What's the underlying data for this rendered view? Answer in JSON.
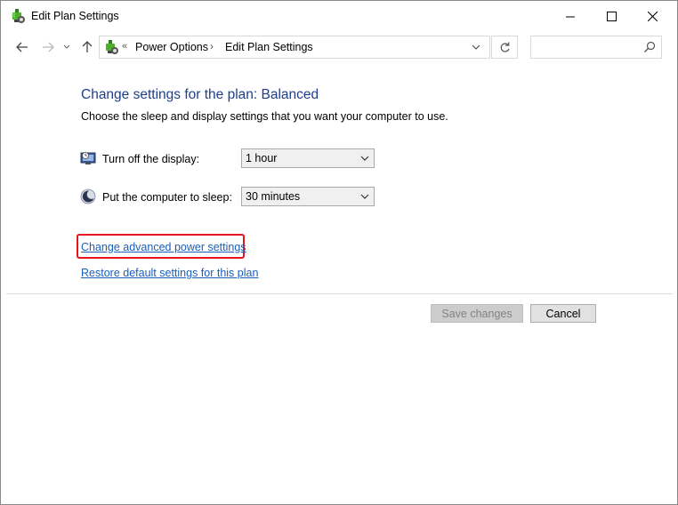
{
  "window": {
    "title": "Edit Plan Settings"
  },
  "address_bar": {
    "overflow_chevron": "«",
    "breadcrumbs": [
      "Power Options",
      "Edit Plan Settings"
    ],
    "separator": "›"
  },
  "search": {
    "placeholder": "",
    "value": ""
  },
  "content": {
    "heading": "Change settings for the plan: Balanced",
    "subtitle": "Choose the sleep and display settings that you want your computer to use.",
    "settings": [
      {
        "label": "Turn off the display:",
        "value": "1 hour",
        "icon": "display-icon"
      },
      {
        "label": "Put the computer to sleep:",
        "value": "30 minutes",
        "icon": "sleep-moon-icon"
      }
    ],
    "links": {
      "advanced": "Change advanced power settings",
      "restore": "Restore default settings for this plan"
    }
  },
  "buttons": {
    "save": "Save changes",
    "cancel": "Cancel"
  },
  "colors": {
    "heading": "#1e3e8c",
    "link": "#1a5eb8",
    "highlight": "#e8141a"
  }
}
